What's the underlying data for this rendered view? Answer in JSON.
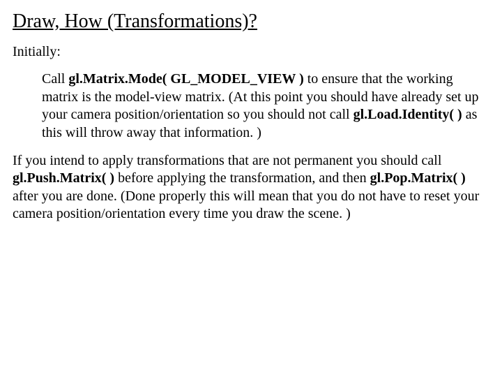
{
  "title": "Draw, How (Transformations)?",
  "initially": "Initially:",
  "p1a": " Call ",
  "p1b": "gl.Matrix.Mode( GL_MODEL_VIEW )",
  "p1c": " to ensure that the working matrix is the model-view matrix. (At this point you should have already set up your camera position/orientation so you should not call ",
  "p1d": "gl.Load.Identity( )",
  "p1e": " as this will throw away that information. )",
  "p2a": "If you intend to apply transformations that are not permanent you should call ",
  "p2b": "gl.Push.Matrix( )",
  "p2c": " before applying the transformation, and then ",
  "p2d": "gl.Pop.Matrix( )",
  "p2e": " after you are done. (Done properly this will mean that you do not have to reset your camera position/orientation every time you draw the scene. )"
}
